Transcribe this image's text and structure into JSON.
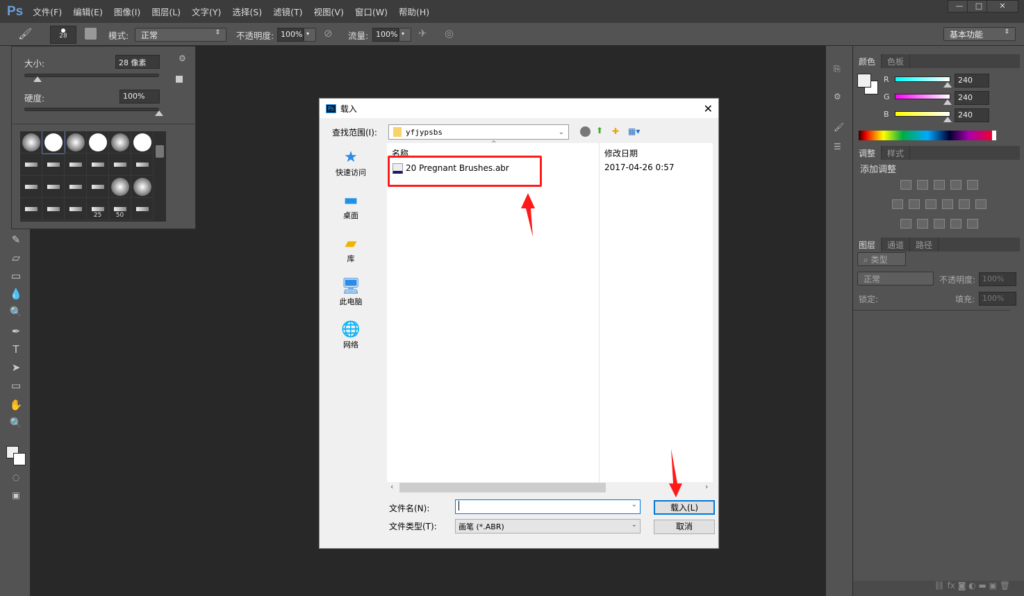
{
  "app": {
    "logo": "Ps",
    "menus": [
      "文件(F)",
      "编辑(E)",
      "图像(I)",
      "图层(L)",
      "文字(Y)",
      "选择(S)",
      "滤镜(T)",
      "视图(V)",
      "窗口(W)",
      "帮助(H)"
    ],
    "window_controls": [
      "—",
      "□",
      "✕"
    ]
  },
  "options": {
    "brush_size": "28",
    "mode_label": "模式:",
    "mode_value": "正常",
    "opacity_label": "不透明度:",
    "opacity_value": "100%",
    "flow_label": "流量:",
    "flow_value": "100%",
    "workspace": "基本功能"
  },
  "brush_popup": {
    "size_label": "大小:",
    "size_value": "28 像素",
    "hardness_label": "硬度:",
    "hardness_value": "100%",
    "size_fraction": 0.1,
    "hardness_fraction": 1.0,
    "presets": [
      "soft",
      "hard",
      "soft",
      "hard",
      "soft",
      "hard",
      "tip",
      "tip",
      "tip",
      "tip",
      "tip",
      "tip",
      "tip",
      "tip",
      "tip",
      "tip",
      "soft",
      "soft",
      "tip",
      "tip",
      "tip",
      "tip",
      "tip",
      "tip"
    ],
    "preset_labels": {
      "21": "25",
      "22": "50"
    }
  },
  "dialog": {
    "title": "载入",
    "look_in_label": "查找范围(I):",
    "look_in_value": "yfjypsbs",
    "places": [
      "快速访问",
      "桌面",
      "库",
      "此电脑",
      "网络"
    ],
    "columns": {
      "name": "名称",
      "date": "修改日期"
    },
    "files": [
      {
        "name": "20 Pregnant Brushes.abr",
        "date": "2017-04-26 0:57"
      }
    ],
    "filename_label": "文件名(N):",
    "filename_value": "",
    "filetype_label": "文件类型(T):",
    "filetype_value": "画笔 (*.ABR)",
    "load_button": "载入(L)",
    "cancel_button": "取消"
  },
  "color_panel": {
    "tabs": [
      "颜色",
      "色板"
    ],
    "channels": [
      {
        "name": "R",
        "value": "240"
      },
      {
        "name": "G",
        "value": "240"
      },
      {
        "name": "B",
        "value": "240"
      }
    ]
  },
  "adjust_panel": {
    "tabs": [
      "调整",
      "样式"
    ],
    "heading": "添加调整"
  },
  "layers_panel": {
    "tabs": [
      "图层",
      "通道",
      "路径"
    ],
    "filter": "类型",
    "blend": "正常",
    "opacity_label": "不透明度:",
    "opacity_value": "100%",
    "lock_label": "锁定:",
    "fill_label": "填充:",
    "fill_value": "100%"
  },
  "colors": {
    "highlight": "#ff1a1a",
    "accent": "#0078d7"
  }
}
